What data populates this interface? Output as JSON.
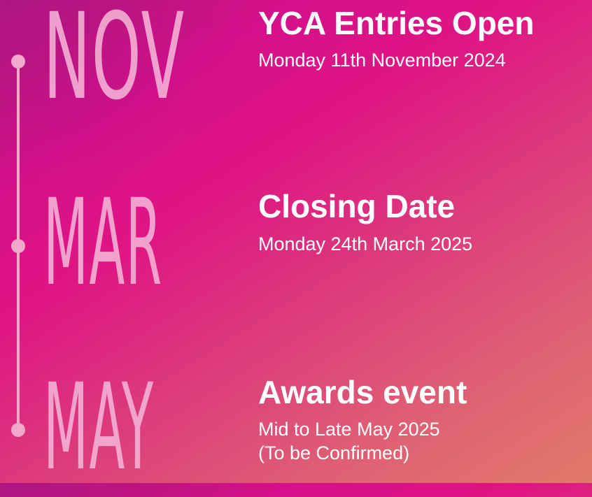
{
  "events": [
    {
      "month": "NOV",
      "title": "YCA Entries Open",
      "detail_lines": [
        "Monday 11th November 2024"
      ]
    },
    {
      "month": "MAR",
      "title": "Closing Date",
      "detail_lines": [
        "Monday 24th March 2025"
      ]
    },
    {
      "month": "MAY",
      "title": "Awards event",
      "detail_lines": [
        "Mid to Late May 2025",
        "(To be Confirmed)"
      ]
    }
  ],
  "colors": {
    "timeline": "#f0a8cc",
    "month_text": "#f5b4d7",
    "heading_text": "#ffffff",
    "gradient_start": "#b3177f",
    "gradient_mid": "#df1584",
    "gradient_end": "#e17a6a"
  }
}
